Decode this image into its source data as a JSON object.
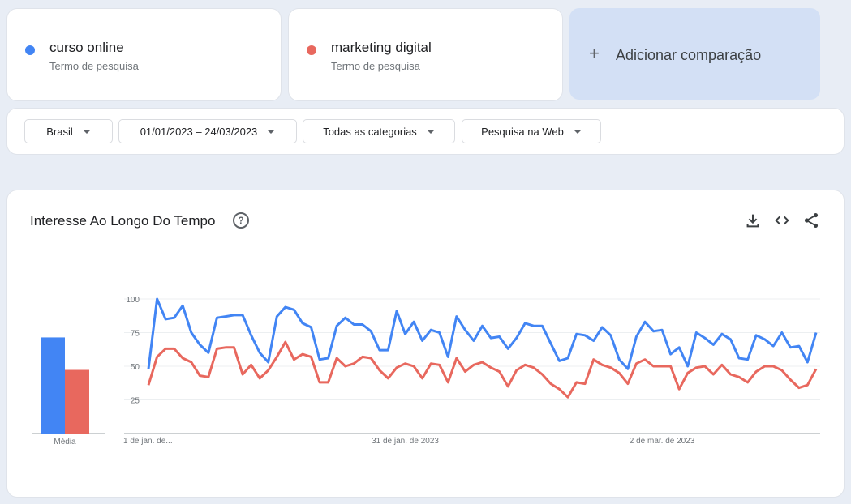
{
  "terms": [
    {
      "name": "curso online",
      "subtitle": "Termo de pesquisa",
      "color": "#4285f4"
    },
    {
      "name": "marketing digital",
      "subtitle": "Termo de pesquisa",
      "color": "#e8685e"
    }
  ],
  "add_comparison": {
    "label": "Adicionar comparação",
    "icon": "plus-icon"
  },
  "filters": {
    "region": "Brasil",
    "date_range": "01/01/2023 – 24/03/2023",
    "category": "Todas as categorias",
    "search_type": "Pesquisa na Web"
  },
  "chart_panel": {
    "title": "Interesse Ao Longo Do Tempo",
    "icons": [
      "help-icon",
      "download-icon",
      "embed-icon",
      "share-icon"
    ]
  },
  "chart_data": [
    {
      "type": "bar",
      "categories": [
        "Média"
      ],
      "series": [
        {
          "name": "curso online",
          "values": [
            71
          ]
        },
        {
          "name": "marketing digital",
          "values": [
            47
          ]
        }
      ],
      "ylim": [
        0,
        100
      ]
    },
    {
      "type": "line",
      "x_tick_labels": [
        "1 de jan. de...",
        "31 de jan. de 2023",
        "2 de mar. de 2023"
      ],
      "x_tick_index": [
        0,
        30,
        60
      ],
      "y_ticks": [
        25,
        50,
        75,
        100
      ],
      "ylim": [
        0,
        100
      ],
      "grid": true,
      "series": [
        {
          "name": "curso online",
          "values": [
            48,
            100,
            85,
            86,
            95,
            75,
            66,
            60,
            86,
            87,
            88,
            88,
            73,
            60,
            53,
            87,
            94,
            92,
            82,
            79,
            55,
            56,
            80,
            86,
            81,
            81,
            76,
            62,
            62,
            91,
            74,
            83,
            69,
            77,
            75,
            57,
            87,
            77,
            69,
            80,
            71,
            72,
            63,
            71,
            82,
            80,
            80,
            67,
            54,
            56,
            74,
            73,
            69,
            79,
            73,
            55,
            48,
            72,
            83,
            76,
            77,
            59,
            64,
            50,
            75,
            71,
            66,
            74,
            70,
            56,
            55,
            73,
            70,
            65,
            75,
            64,
            65,
            53,
            75
          ]
        },
        {
          "name": "marketing digital",
          "values": [
            36,
            57,
            63,
            63,
            56,
            53,
            43,
            42,
            63,
            64,
            64,
            44,
            51,
            41,
            47,
            57,
            68,
            55,
            59,
            57,
            38,
            38,
            56,
            50,
            52,
            57,
            56,
            47,
            41,
            49,
            52,
            50,
            41,
            52,
            51,
            38,
            56,
            46,
            51,
            53,
            49,
            46,
            35,
            47,
            51,
            49,
            44,
            37,
            33,
            27,
            38,
            37,
            55,
            51,
            49,
            45,
            37,
            52,
            55,
            50,
            50,
            50,
            33,
            45,
            49,
            50,
            44,
            51,
            44,
            42,
            38,
            46,
            50,
            50,
            47,
            40,
            34,
            36,
            48
          ]
        }
      ]
    }
  ]
}
